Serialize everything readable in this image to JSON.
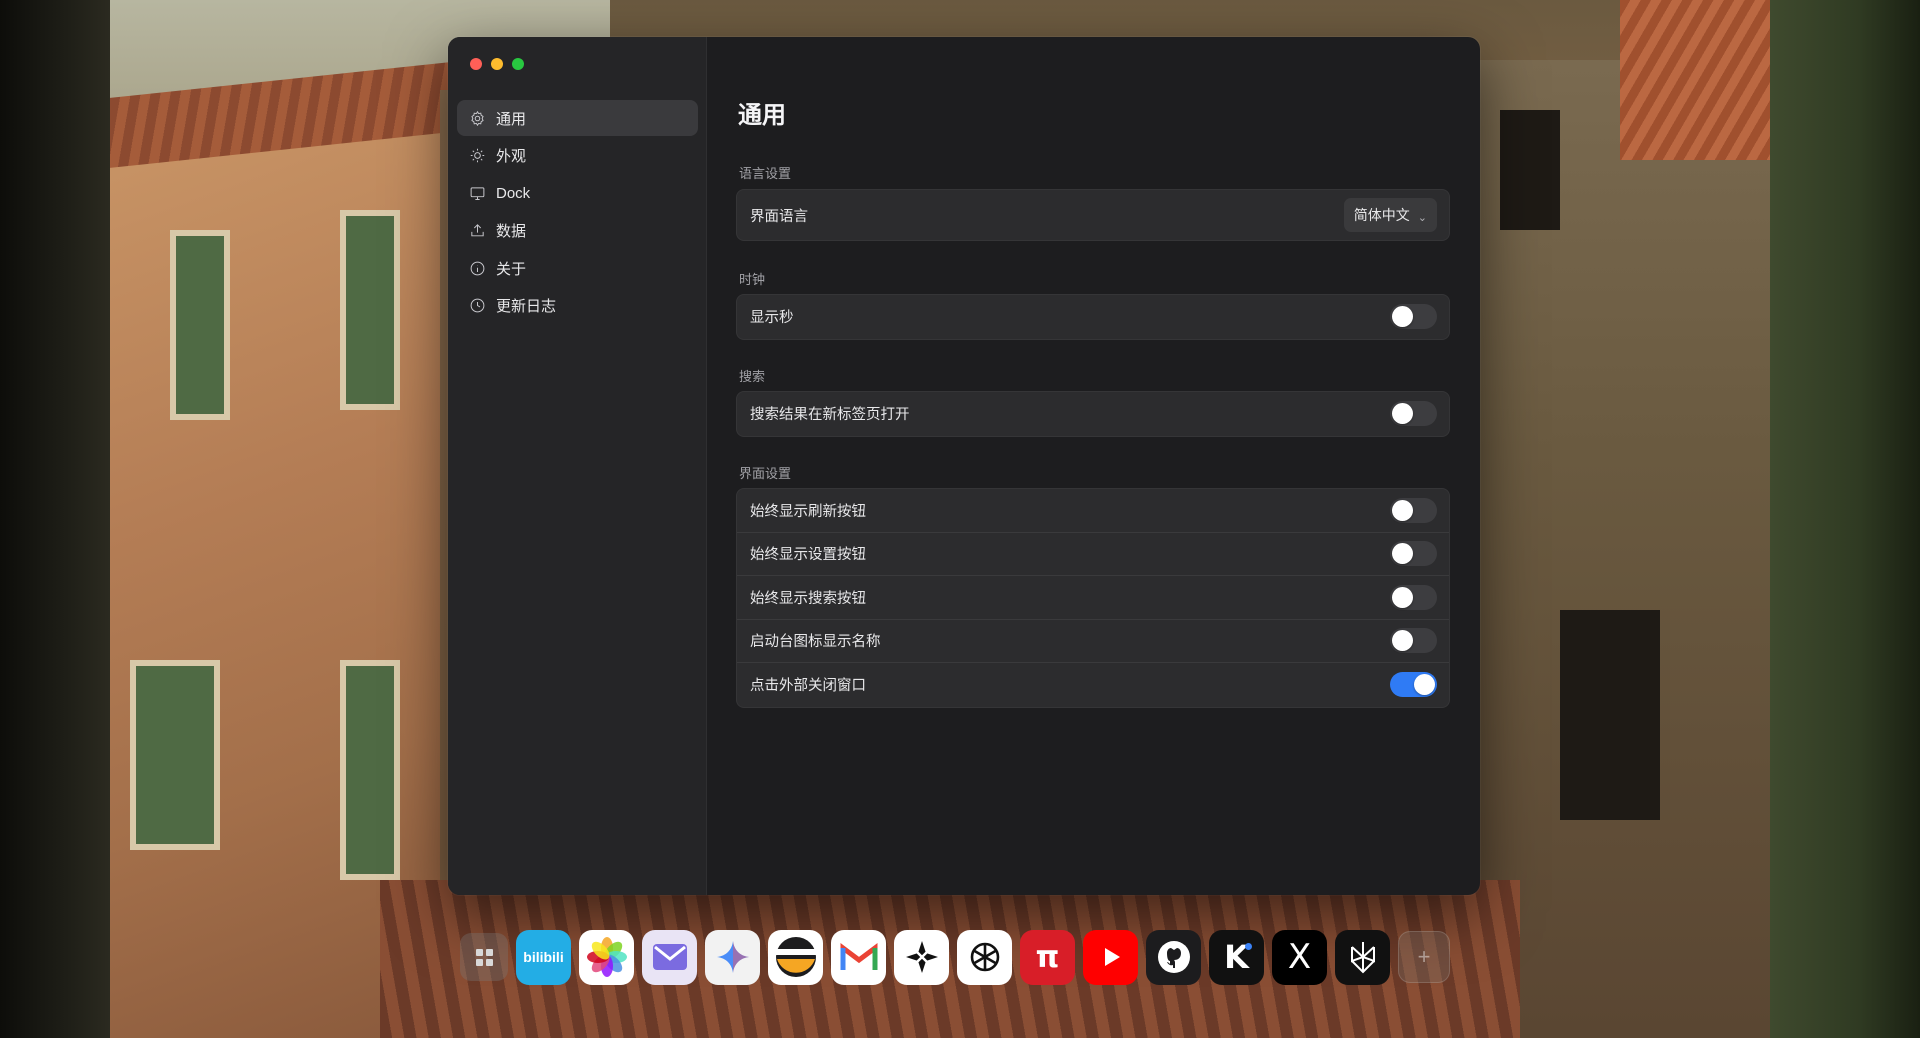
{
  "window": {
    "sidebar": {
      "items": [
        {
          "label": "通用",
          "icon": "gear-icon",
          "active": true
        },
        {
          "label": "外观",
          "icon": "sun-icon",
          "active": false
        },
        {
          "label": "Dock",
          "icon": "monitor-icon",
          "active": false
        },
        {
          "label": "数据",
          "icon": "upload-icon",
          "active": false
        },
        {
          "label": "关于",
          "icon": "info-icon",
          "active": false
        },
        {
          "label": "更新日志",
          "icon": "clock-icon",
          "active": false
        }
      ]
    },
    "page_title": "通用",
    "sections": {
      "language": {
        "label": "语言设置",
        "row_label": "界面语言",
        "select_value": "简体中文"
      },
      "clock": {
        "label": "时钟",
        "rows": [
          {
            "label": "显示秒",
            "on": false
          }
        ]
      },
      "search": {
        "label": "搜索",
        "rows": [
          {
            "label": "搜索结果在新标签页打开",
            "on": false
          }
        ]
      },
      "interface": {
        "label": "界面设置",
        "rows": [
          {
            "label": "始终显示刷新按钮",
            "on": false
          },
          {
            "label": "始终显示设置按钮",
            "on": false
          },
          {
            "label": "始终显示搜索按钮",
            "on": false
          },
          {
            "label": "启动台图标显示名称",
            "on": false
          },
          {
            "label": "点击外部关闭窗口",
            "on": true
          }
        ]
      }
    }
  },
  "dock": {
    "apps": [
      {
        "name": "launchpad-icon"
      },
      {
        "name": "bilibili-icon",
        "text": "bilibili",
        "color": "#23ade5"
      },
      {
        "name": "photos-icon",
        "color": "#ffffff"
      },
      {
        "name": "mail-icon",
        "color": "#e9e4f5"
      },
      {
        "name": "gemini-icon",
        "color": "#f2f2f2"
      },
      {
        "name": "stripe-app-icon",
        "color": "#ffffff"
      },
      {
        "name": "gmail-icon",
        "color": "#ffffff"
      },
      {
        "name": "perplexity-like-icon",
        "color": "#ffffff"
      },
      {
        "name": "openai-icon",
        "color": "#ffffff"
      },
      {
        "name": "pi-icon",
        "text": "π",
        "color": "#d81e28"
      },
      {
        "name": "youtube-icon",
        "color": "#ff0000"
      },
      {
        "name": "github-icon",
        "color": "#1c1c1e"
      },
      {
        "name": "kimi-icon",
        "text": "K",
        "color": "#111111"
      },
      {
        "name": "x-icon",
        "text": "X",
        "color": "#000000"
      },
      {
        "name": "perplexity-icon",
        "color": "#111111"
      },
      {
        "name": "add-app-icon",
        "text": "+"
      }
    ]
  },
  "colors": {
    "toggle_on": "#2f7bf5",
    "toggle_off": "#3d3d40",
    "window_bg": "#1d1d1f",
    "sidebar_bg": "#252527",
    "group_bg": "#2c2c2e"
  }
}
